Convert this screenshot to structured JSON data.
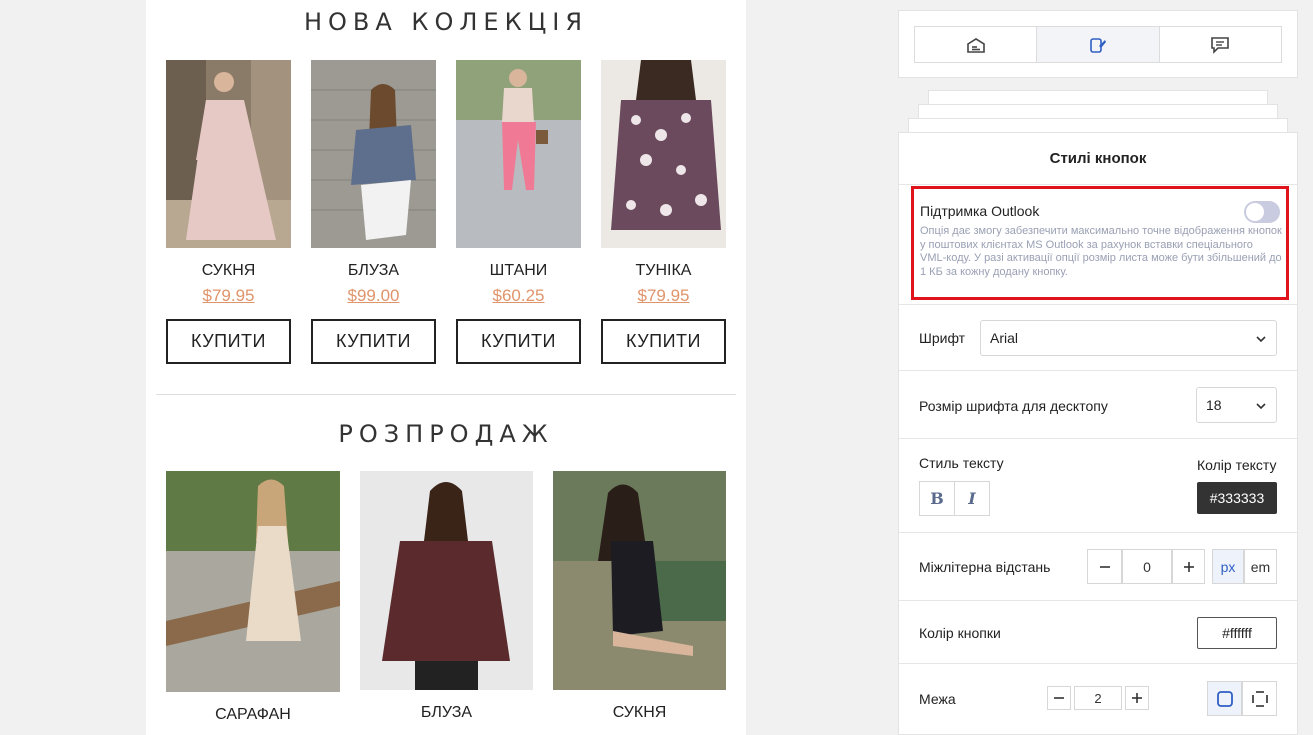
{
  "email": {
    "new_collection_title": "НОВА КОЛЕКЦІЯ",
    "sale_title": "РОЗПРОДАЖ",
    "products": [
      {
        "name": "СУКНЯ",
        "price": "$79.95",
        "button": "КУПИТИ"
      },
      {
        "name": "БЛУЗА",
        "price": "$99.00",
        "button": "КУПИТИ"
      },
      {
        "name": "ШТАНИ",
        "price": "$60.25",
        "button": "КУПИТИ"
      },
      {
        "name": "ТУНІКА",
        "price": "$79.95",
        "button": "КУПИТИ"
      }
    ],
    "sale_products": [
      {
        "name": "САРАФАН"
      },
      {
        "name": "БЛУЗА"
      },
      {
        "name": "СУКНЯ"
      }
    ]
  },
  "panel": {
    "tabs": [
      {
        "icon": "content-block-icon"
      },
      {
        "icon": "style-brush-icon"
      },
      {
        "icon": "comment-icon"
      }
    ],
    "title": "Стилі кнопок",
    "outlook_label": "Підтримка Outlook",
    "outlook_desc": "Опція дає змогу забезпечити максимально точне відображення кнопок у поштових клієнтах MS Outlook за рахунок вставки спеціального VML-коду. У разі активації опції розмір листа може бути збільшений до 1 КБ за кожну додану кнопку.",
    "font_label": "Шрифт",
    "font_value": "Arial",
    "font_size_label": "Розмір шрифта для десктопу",
    "font_size_value": "18",
    "text_style_label": "Стиль тексту",
    "bold": "B",
    "italic": "I",
    "text_color_label": "Колір тексту",
    "text_color_value": "#333333",
    "letter_spacing_label": "Міжлітерна відстань",
    "letter_spacing_value": "0",
    "unit_px": "px",
    "unit_em": "em",
    "button_color_label": "Колір кнопки",
    "button_color_value": "#ffffff",
    "border_label": "Межа",
    "border_value": "2"
  },
  "colors": {
    "accent": "#3a5fc9",
    "price": "#e0946b",
    "highlight": "#e0141c"
  }
}
